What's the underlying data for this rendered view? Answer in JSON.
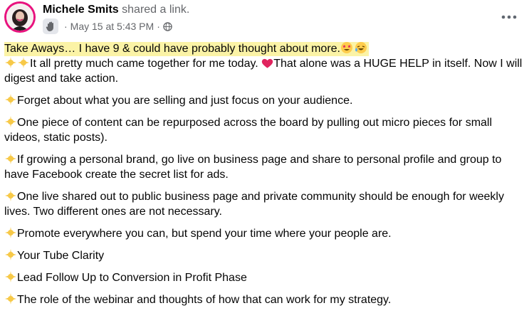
{
  "post": {
    "author": "Michele Smits",
    "action": "shared a link.",
    "timestamp": "May 15 at 5:43 PM",
    "separator": "·",
    "privacy_icon": "globe-icon",
    "group_icon": "hand-icon",
    "more_icon": "more-horizontal-icon"
  },
  "colors": {
    "avatar_ring": "#e8137e",
    "highlight": "#fbf3a6",
    "heart": "#e0245e",
    "sparkle": "#f7c948"
  },
  "body": {
    "highlight_text": "Take Aways… I have 9 & could have probably thought about more.",
    "intro_a": "It all pretty much came together for me today. ",
    "intro_b": "That alone was a HUGE HELP in itself. Now I will digest and take action.",
    "points": [
      "Forget about what you are selling and just focus on your audience.",
      "One piece of content can be repurposed across the board by pulling out micro pieces for small videos, static posts).",
      "If growing a personal brand, go live on business page and share to personal profile and group to have Facebook create the secret list for ads.",
      "One live shared out to public business page and private community should be enough for weekly lives. Two different ones are not necessary.",
      "Promote everywhere you can, but spend your time where your people are.",
      "Your Tube Clarity",
      "Lead Follow Up to Conversion in Profit Phase",
      "The role of the webinar and thoughts of how that can work for my strategy."
    ]
  }
}
